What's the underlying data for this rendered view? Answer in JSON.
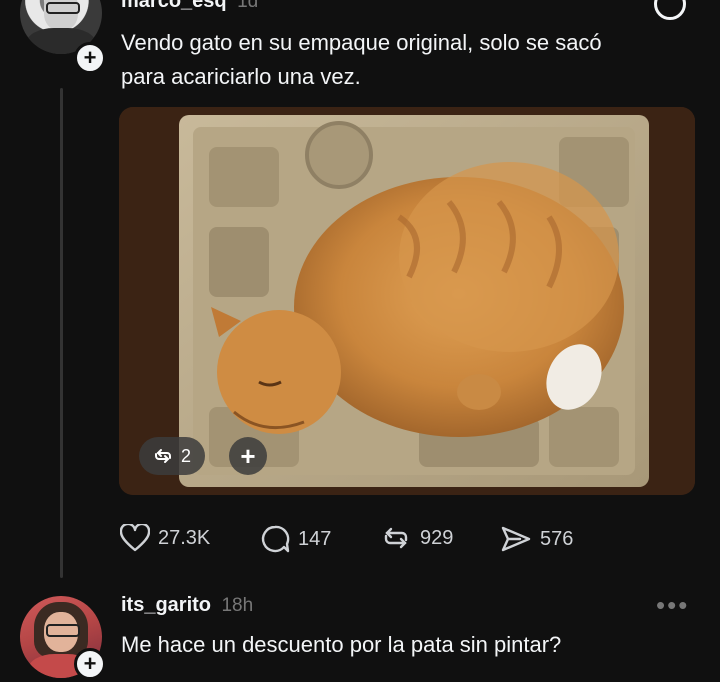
{
  "post1": {
    "username": "marco_esq",
    "timestamp": "1d",
    "text_line1": "Vendo gato en su empaque original, solo se sacó",
    "text_line2": "para acariciarlo una vez.",
    "media": {
      "repost_count": "2",
      "plus_label": "+"
    },
    "actions": {
      "likes": "27.3K",
      "replies": "147",
      "reposts": "929",
      "shares": "576"
    }
  },
  "post2": {
    "username": "its_garito",
    "timestamp": "18h",
    "text": "Me hace un descuento por la pata sin pintar?"
  },
  "badge_plus": "+",
  "colors": {
    "background": "#101010",
    "text": "#f3f5f7",
    "muted": "#777777",
    "thread_line": "#333333"
  }
}
